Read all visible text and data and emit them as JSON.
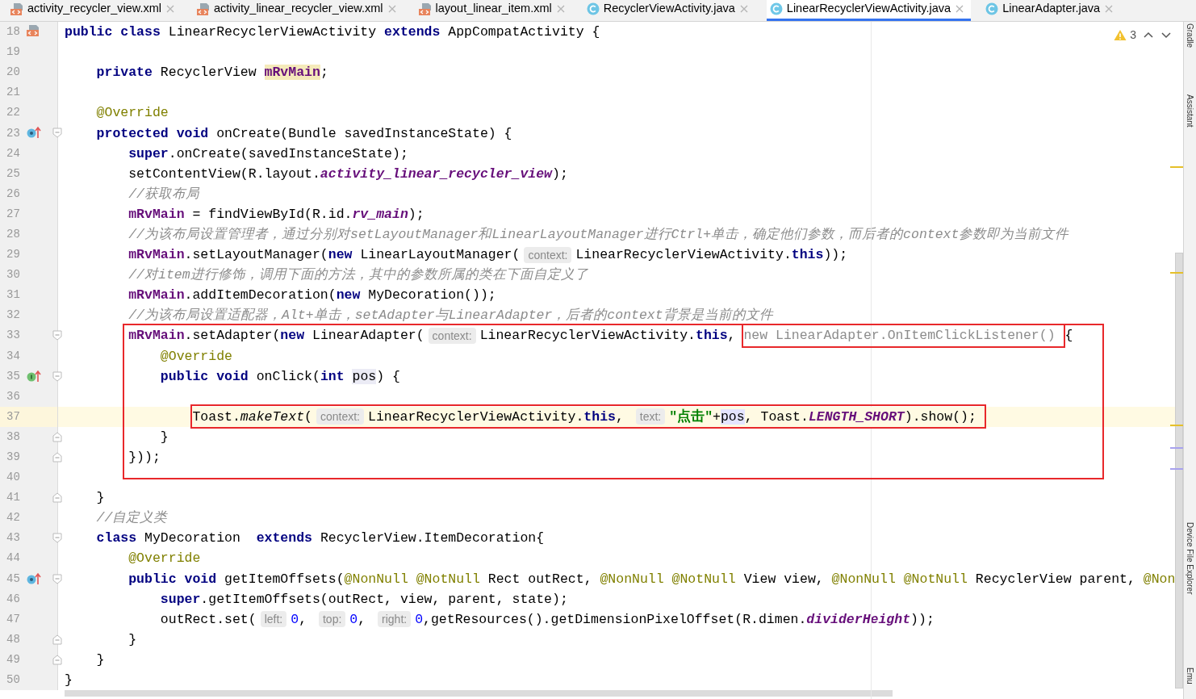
{
  "tabs": [
    {
      "label": "activity_recycler_view.xml",
      "kind": "xml",
      "selected": false
    },
    {
      "label": "activity_linear_recycler_view.xml",
      "kind": "xml",
      "selected": false
    },
    {
      "label": "layout_linear_item.xml",
      "kind": "xml",
      "selected": false
    },
    {
      "label": "RecyclerViewActivity.java",
      "kind": "java",
      "selected": false
    },
    {
      "label": "LinearRecyclerViewActivity.java",
      "kind": "java",
      "selected": true
    },
    {
      "label": "LinearAdapter.java",
      "kind": "java",
      "selected": false
    }
  ],
  "inspections": {
    "count": "3"
  },
  "tool_windows": [
    "Gradle",
    "Assistant",
    "Device File Explorer",
    "Emu"
  ],
  "lines": [
    {
      "kind": "line",
      "number": "18",
      "gutter": {
        "kind": "layout"
      },
      "current": false,
      "tokens": [
        {
          "text": "public class ",
          "kind": "keyword"
        },
        {
          "text": "LinearRecyclerViewActivity ",
          "kind": "plain"
        },
        {
          "text": "extends ",
          "kind": "keyword"
        },
        {
          "text": "AppCompatActivity {",
          "kind": "plain"
        }
      ],
      "children": [
        {
          "kind": "line",
          "number": "19",
          "current": false
        },
        {
          "kind": "line",
          "number": "20",
          "current": false,
          "tokens": [
            {
              "text": "private ",
              "kind": "keyword"
            },
            {
              "text": "RecyclerView ",
              "kind": "plain"
            },
            {
              "text": "mRvMain",
              "kind": "field_hl"
            },
            {
              "text": ";",
              "kind": "plain"
            }
          ]
        },
        {
          "kind": "line",
          "number": "21",
          "current": false
        },
        {
          "kind": "line",
          "number": "22",
          "current": false,
          "tokens": [
            {
              "text": "@Override",
              "kind": "annotation"
            }
          ]
        },
        {
          "kind": "line",
          "number": "23",
          "gutter": {
            "kind": "override"
          },
          "fold": {
            "kind": "start"
          },
          "current": false,
          "tokens": [
            {
              "text": "protected void ",
              "kind": "keyword"
            },
            {
              "text": "onCreate(Bundle savedInstanceState) {",
              "kind": "plain"
            }
          ],
          "children": [
            {
              "kind": "line",
              "number": "24",
              "current": false,
              "tokens": [
                {
                  "text": "super",
                  "kind": "keyword"
                },
                {
                  "text": ".onCreate(savedInstanceState);",
                  "kind": "plain"
                }
              ]
            },
            {
              "kind": "line",
              "number": "25",
              "current": false,
              "tokens": [
                {
                  "text": "setContentView(R.layout.",
                  "kind": "plain"
                },
                {
                  "text": "activity_linear_recycler_view",
                  "kind": "static"
                },
                {
                  "text": ");",
                  "kind": "plain"
                }
              ]
            },
            {
              "kind": "line",
              "number": "26",
              "current": false,
              "tokens": [
                {
                  "text": "//获取布局",
                  "kind": "comment"
                }
              ]
            },
            {
              "kind": "line",
              "number": "27",
              "current": false,
              "tokens": [
                {
                  "text": "mRvMain",
                  "kind": "field"
                },
                {
                  "text": " = findViewById(R.id.",
                  "kind": "plain"
                },
                {
                  "text": "rv_main",
                  "kind": "static"
                },
                {
                  "text": ");",
                  "kind": "plain"
                }
              ]
            },
            {
              "kind": "line",
              "number": "28",
              "current": false,
              "tokens": [
                {
                  "text": "//为该布局设置管理者，通过分别对setLayoutManager和LinearLayoutManager进行Ctrl+单击，确定他们参数，而后者的context参数即为当前文件",
                  "kind": "comment"
                }
              ]
            },
            {
              "kind": "line",
              "number": "29",
              "current": false,
              "tokens": [
                {
                  "text": "mRvMain",
                  "kind": "field"
                },
                {
                  "text": ".setLayoutManager(",
                  "kind": "plain"
                },
                {
                  "text": "new",
                  "kind": "keyword"
                },
                {
                  "text": " LinearLayoutManager(",
                  "kind": "plain"
                },
                {
                  "text": "context:",
                  "kind": "hint"
                },
                {
                  "text": "LinearRecyclerViewActivity.",
                  "kind": "plain"
                },
                {
                  "text": "this",
                  "kind": "keyword"
                },
                {
                  "text": "));",
                  "kind": "plain"
                }
              ]
            },
            {
              "kind": "line",
              "number": "30",
              "current": false,
              "tokens": [
                {
                  "text": "//对item进行修饰，调用下面的方法，其中的参数所属的类在下面自定义了",
                  "kind": "comment"
                }
              ]
            },
            {
              "kind": "line",
              "number": "31",
              "current": false,
              "tokens": [
                {
                  "text": "mRvMain",
                  "kind": "field"
                },
                {
                  "text": ".addItemDecoration(",
                  "kind": "plain"
                },
                {
                  "text": "new",
                  "kind": "keyword"
                },
                {
                  "text": " MyDecoration());",
                  "kind": "plain"
                }
              ]
            },
            {
              "kind": "line",
              "number": "32",
              "current": false,
              "tokens": [
                {
                  "text": "//为该布局设置适配器，Alt+单击，setAdapter与LinearAdapter，后者的context背景是当前的文件",
                  "kind": "comment"
                }
              ]
            },
            {
              "kind": "frame",
              "lines": [
                {
                  "kind": "line",
                  "number": "33",
                  "fold": {
                    "kind": "start"
                  },
                  "current": false,
                  "tokens": [
                    {
                      "text": "mRvMain",
                      "kind": "field"
                    },
                    {
                      "text": ".setAdapter(",
                      "kind": "plain"
                    },
                    {
                      "text": "new",
                      "kind": "keyword"
                    },
                    {
                      "text": " LinearAdapter(",
                      "kind": "plain"
                    },
                    {
                      "text": "context:",
                      "kind": "hint"
                    },
                    {
                      "text": "LinearRecyclerViewActivity.",
                      "kind": "plain"
                    },
                    {
                      "text": "this",
                      "kind": "keyword"
                    },
                    {
                      "text": ", ",
                      "kind": "plain"
                    },
                    {
                      "kind": "frame",
                      "tokens": [
                        {
                          "text": "new LinearAdapter.OnItemClickListener()",
                          "kind": "greyed"
                        }
                      ]
                    },
                    {
                      "text": "{",
                      "kind": "plain"
                    }
                  ],
                  "children": [
                    {
                      "kind": "line",
                      "number": "34",
                      "current": false,
                      "tokens": [
                        {
                          "text": "@Override",
                          "kind": "annotation"
                        }
                      ]
                    },
                    {
                      "kind": "line",
                      "number": "35",
                      "gutter": {
                        "kind": "implement"
                      },
                      "fold": {
                        "kind": "start"
                      },
                      "current": false,
                      "tokens": [
                        {
                          "text": "public void ",
                          "kind": "keyword"
                        },
                        {
                          "text": "onClick(",
                          "kind": "plain"
                        },
                        {
                          "text": "int ",
                          "kind": "keyword"
                        },
                        {
                          "text": "pos",
                          "kind": "param_hl"
                        },
                        {
                          "text": ") {",
                          "kind": "plain"
                        }
                      ],
                      "children": [
                        {
                          "kind": "line",
                          "number": "36",
                          "current": false
                        },
                        {
                          "kind": "line",
                          "number": "37",
                          "current": true,
                          "tokens": [
                            {
                              "kind": "frame",
                              "tokens": [
                                {
                                  "text": "Toast.",
                                  "kind": "plain"
                                },
                                {
                                  "text": "makeText",
                                  "kind": "static_call"
                                },
                                {
                                  "text": "(",
                                  "kind": "plain"
                                },
                                {
                                  "text": "context:",
                                  "kind": "hint"
                                },
                                {
                                  "text": "LinearRecyclerViewActivity.",
                                  "kind": "plain"
                                },
                                {
                                  "text": "this",
                                  "kind": "keyword"
                                },
                                {
                                  "text": ", ",
                                  "kind": "plain"
                                },
                                {
                                  "text": "text:",
                                  "kind": "hint"
                                },
                                {
                                  "text": "\"点击\"",
                                  "kind": "string"
                                },
                                {
                                  "text": "+",
                                  "kind": "plain"
                                },
                                {
                                  "text": "pos",
                                  "kind": "usage_hl"
                                },
                                {
                                  "text": ", Toast.",
                                  "kind": "plain"
                                },
                                {
                                  "text": "LENGTH_SHORT",
                                  "kind": "static"
                                },
                                {
                                  "text": ").show();",
                                  "kind": "plain"
                                }
                              ]
                            }
                          ]
                        }
                      ]
                    },
                    {
                      "kind": "line",
                      "number": "38",
                      "fold": {
                        "kind": "end"
                      },
                      "current": false,
                      "tokens": [
                        {
                          "text": "}",
                          "kind": "plain"
                        }
                      ]
                    }
                  ]
                },
                {
                  "kind": "line",
                  "number": "39",
                  "fold": {
                    "kind": "end"
                  },
                  "current": false,
                  "tokens": [
                    {
                      "text": "}));",
                      "kind": "plain"
                    }
                  ]
                },
                {
                  "kind": "line",
                  "number": "40",
                  "current": false
                }
              ]
            }
          ]
        },
        {
          "kind": "line",
          "number": "41",
          "fold": {
            "kind": "end"
          },
          "current": false,
          "tokens": [
            {
              "text": "}",
              "kind": "plain"
            }
          ]
        },
        {
          "kind": "line",
          "number": "42",
          "current": false,
          "tokens": [
            {
              "text": "//自定义类",
              "kind": "comment"
            }
          ]
        },
        {
          "kind": "line",
          "number": "43",
          "fold": {
            "kind": "start"
          },
          "current": false,
          "tokens": [
            {
              "text": "class ",
              "kind": "keyword"
            },
            {
              "text": "MyDecoration  ",
              "kind": "plain"
            },
            {
              "text": "extends ",
              "kind": "keyword"
            },
            {
              "text": "RecyclerView.ItemDecoration{",
              "kind": "plain"
            }
          ],
          "children": [
            {
              "kind": "line",
              "number": "44",
              "current": false,
              "tokens": [
                {
                  "text": "@Override",
                  "kind": "annotation"
                }
              ]
            },
            {
              "kind": "line",
              "number": "45",
              "gutter": {
                "kind": "override"
              },
              "fold": {
                "kind": "start"
              },
              "current": false,
              "tokens": [
                {
                  "text": "public void ",
                  "kind": "keyword"
                },
                {
                  "text": "getItemOffsets(",
                  "kind": "plain"
                },
                {
                  "text": "@NonNull @NotNull ",
                  "kind": "annotation"
                },
                {
                  "text": "Rect outRect, ",
                  "kind": "plain"
                },
                {
                  "text": "@NonNull @NotNull ",
                  "kind": "annotation"
                },
                {
                  "text": "View view, ",
                  "kind": "plain"
                },
                {
                  "text": "@NonNull @NotNull ",
                  "kind": "annotation"
                },
                {
                  "text": "RecyclerView parent, ",
                  "kind": "plain"
                },
                {
                  "text": "@Non",
                  "kind": "annotation"
                }
              ],
              "children": [
                {
                  "kind": "line",
                  "number": "46",
                  "current": false,
                  "tokens": [
                    {
                      "text": "super",
                      "kind": "keyword"
                    },
                    {
                      "text": ".getItemOffsets(outRect, view, parent, state);",
                      "kind": "plain"
                    }
                  ]
                },
                {
                  "kind": "line",
                  "number": "47",
                  "current": false,
                  "tokens": [
                    {
                      "text": "outRect.set(",
                      "kind": "plain"
                    },
                    {
                      "text": "left:",
                      "kind": "hint"
                    },
                    {
                      "text": "0",
                      "kind": "number"
                    },
                    {
                      "text": ", ",
                      "kind": "plain"
                    },
                    {
                      "text": "top:",
                      "kind": "hint"
                    },
                    {
                      "text": "0",
                      "kind": "number"
                    },
                    {
                      "text": ", ",
                      "kind": "plain"
                    },
                    {
                      "text": "right:",
                      "kind": "hint"
                    },
                    {
                      "text": "0",
                      "kind": "number"
                    },
                    {
                      "text": ",getResources().getDimensionPixelOffset(R.dimen.",
                      "kind": "plain"
                    },
                    {
                      "text": "dividerHeight",
                      "kind": "static"
                    },
                    {
                      "text": "));",
                      "kind": "plain"
                    }
                  ]
                }
              ]
            },
            {
              "kind": "line",
              "number": "48",
              "fold": {
                "kind": "end"
              },
              "current": false,
              "tokens": [
                {
                  "text": "}",
                  "kind": "plain"
                }
              ]
            }
          ]
        },
        {
          "kind": "line",
          "number": "49",
          "fold": {
            "kind": "end"
          },
          "current": false,
          "tokens": [
            {
              "text": "}",
              "kind": "plain"
            }
          ]
        }
      ]
    },
    {
      "kind": "line",
      "number": "50",
      "current": false,
      "tokens": [
        {
          "text": "}",
          "kind": "plain"
        }
      ]
    }
  ]
}
